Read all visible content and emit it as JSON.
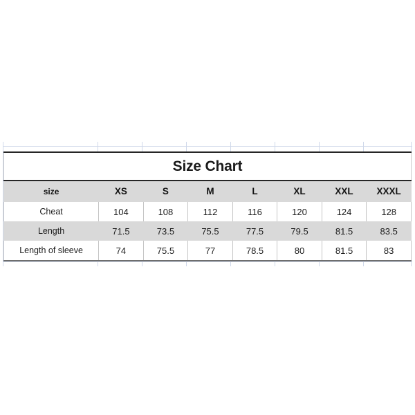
{
  "chart_data": {
    "type": "table",
    "title": "Size Chart",
    "columns": [
      "size",
      "XS",
      "S",
      "M",
      "L",
      "XL",
      "XXL",
      "XXXL"
    ],
    "row_labels": [
      "Cheat",
      "Length",
      "Length of sleeve"
    ],
    "rows": [
      {
        "label": "Cheat",
        "values": [
          "104",
          "108",
          "112",
          "116",
          "120",
          "124",
          "128"
        ]
      },
      {
        "label": "Length",
        "values": [
          "71.5",
          "73.5",
          "75.5",
          "77.5",
          "79.5",
          "81.5",
          "83.5"
        ]
      },
      {
        "label": "Length of sleeve",
        "values": [
          "74",
          "75.5",
          "77",
          "78.5",
          "80",
          "81.5",
          "83"
        ]
      }
    ],
    "series": [
      {
        "name": "Cheat",
        "values": [
          104,
          108,
          112,
          116,
          120,
          124,
          128
        ]
      },
      {
        "name": "Length",
        "values": [
          71.5,
          73.5,
          75.5,
          77.5,
          79.5,
          81.5,
          83.5
        ]
      },
      {
        "name": "Length of sleeve",
        "values": [
          74,
          75.5,
          77,
          78.5,
          80,
          81.5,
          83
        ]
      }
    ],
    "categories": [
      "XS",
      "S",
      "M",
      "L",
      "XL",
      "XXL",
      "XXXL"
    ],
    "xlabel": "",
    "ylabel": "",
    "legend": "none",
    "grid": true,
    "colors": {
      "header_background": "#d9d9d9",
      "alt_row_background": "#d9d9d9",
      "row_background": "#ffffff",
      "border": "#262626",
      "text": "#1a1a1a",
      "gridline": "#cfd8ea"
    }
  }
}
